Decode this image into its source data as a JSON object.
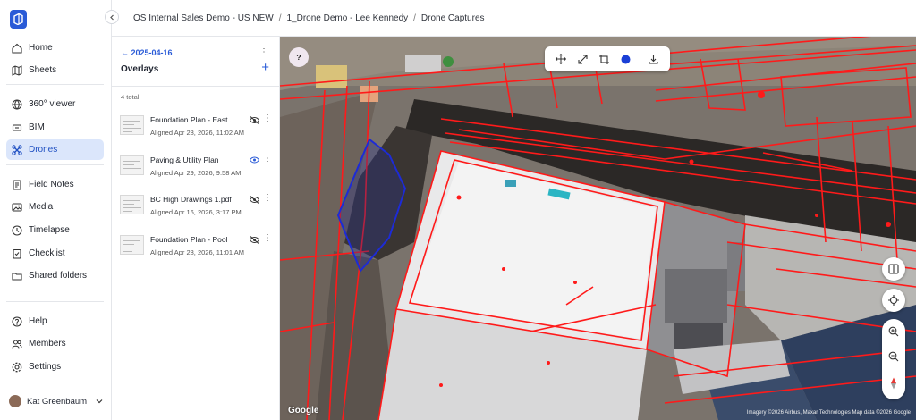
{
  "nav": {
    "items": [
      {
        "label": "Home",
        "icon": "home-icon"
      },
      {
        "label": "Sheets",
        "icon": "map-icon"
      },
      {
        "label": "360° viewer",
        "icon": "globe-icon"
      },
      {
        "label": "BIM",
        "icon": "bim-icon"
      },
      {
        "label": "Drones",
        "icon": "drone-icon"
      },
      {
        "label": "Field Notes",
        "icon": "notes-icon"
      },
      {
        "label": "Media",
        "icon": "image-icon"
      },
      {
        "label": "Timelapse",
        "icon": "timelapse-icon"
      },
      {
        "label": "Checklist",
        "icon": "checklist-icon"
      },
      {
        "label": "Shared folders",
        "icon": "folder-icon"
      },
      {
        "label": "Help",
        "icon": "help-icon"
      },
      {
        "label": "Members",
        "icon": "members-icon"
      },
      {
        "label": "Settings",
        "icon": "settings-icon"
      }
    ],
    "active": "Drones",
    "user": "Kat Greenbaum"
  },
  "breadcrumb": {
    "items": [
      "OS Internal Sales Demo - US NEW",
      "1_Drone Demo - Lee Kennedy",
      "Drone Captures"
    ],
    "separator": "/"
  },
  "panel": {
    "date": "← 2025-04-16",
    "title": "Overlays",
    "add": "+",
    "more": "⋮",
    "total": "4 total",
    "overlays": [
      {
        "name": "Foundation Plan - East Wing",
        "sub": "Aligned Apr 28, 2026, 11:02 AM",
        "visible": false
      },
      {
        "name": "Paving & Utility Plan",
        "sub": "Aligned Apr 29, 2026, 9:58 AM",
        "visible": true
      },
      {
        "name": "BC High Drawings 1.pdf",
        "sub": "Aligned Apr 16, 2026, 3:17 PM",
        "visible": false
      },
      {
        "name": "Foundation Plan - Pool",
        "sub": "Aligned Apr 28, 2026, 11:01 AM",
        "visible": false
      }
    ]
  },
  "map": {
    "help": "?",
    "google": "Google",
    "attribution": "Imagery ©2026 Airbus, Maxar Technologies  Map data ©2026  Google"
  },
  "colors": {
    "accent": "#2a5bd7",
    "overlay": "#ff1a1a",
    "polygon": "#1d2bd6"
  }
}
